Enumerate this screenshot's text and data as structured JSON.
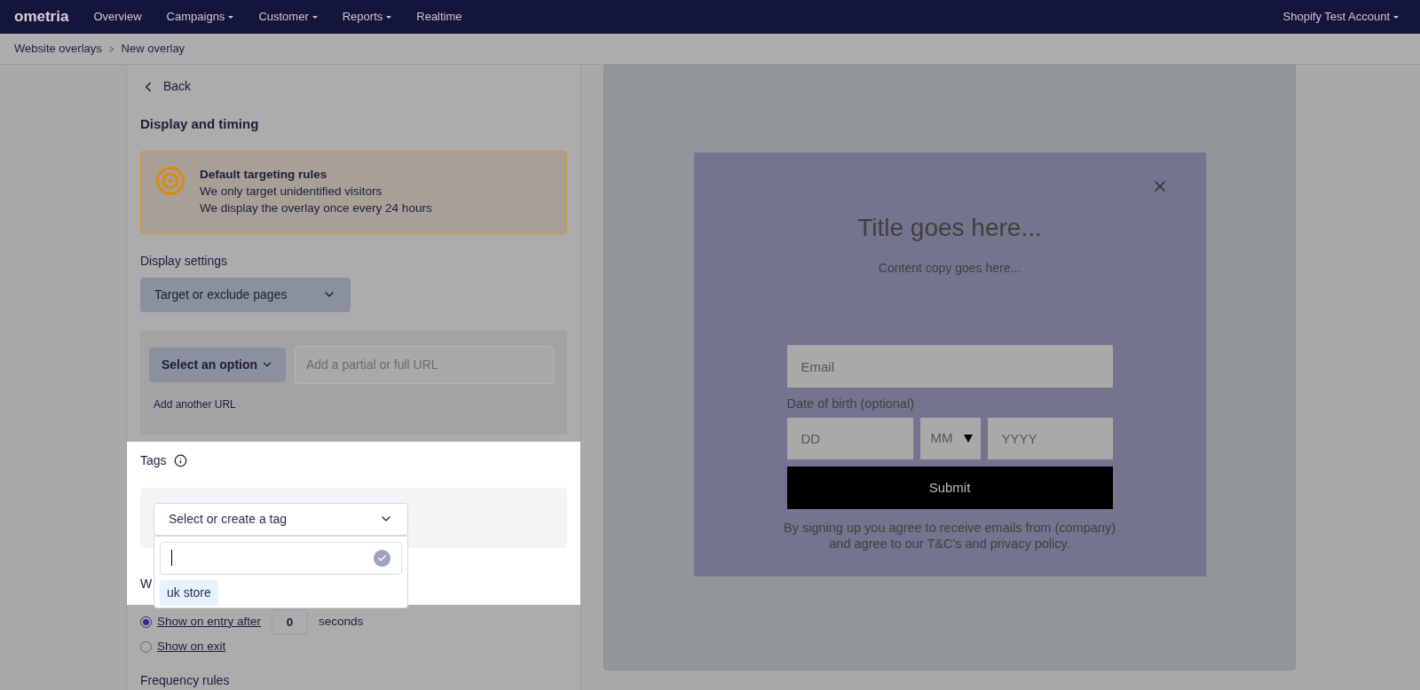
{
  "nav": {
    "logo": "ometria",
    "items": [
      {
        "label": "Overview",
        "dropdown": false
      },
      {
        "label": "Campaigns",
        "dropdown": true
      },
      {
        "label": "Customer",
        "dropdown": true
      },
      {
        "label": "Reports",
        "dropdown": true
      },
      {
        "label": "Realtime",
        "dropdown": false
      }
    ],
    "account": {
      "label": "Shopify Test Account",
      "dropdown": true
    }
  },
  "breadcrumb": {
    "items": [
      "Website overlays",
      "New overlay"
    ],
    "separator": ">"
  },
  "panel": {
    "back": "Back",
    "heading": "Display and timing",
    "alert": {
      "title": "Default targeting rules",
      "lines": [
        "We only target unidentified visitors",
        "We display the overlay once every 24 hours"
      ]
    },
    "display_settings": {
      "label": "Display settings",
      "dropdown": "Target or exclude pages"
    },
    "url_rule": {
      "select": "Select an option",
      "placeholder": "Add a partial or full URL",
      "add_link": "Add another URL"
    },
    "tags": {
      "label": "Tags",
      "select_placeholder": "Select or create a tag",
      "menu": {
        "options": [
          {
            "label": "uk store",
            "highlighted": true
          }
        ]
      }
    },
    "timing": {
      "label": "W",
      "options": [
        {
          "label": "Show on entry after",
          "selected": true,
          "kind": "delay",
          "value": "0",
          "unit": "seconds"
        },
        {
          "label": "Show on exit",
          "selected": false,
          "kind": "plain"
        }
      ]
    },
    "frequency_label": "Frequency rules"
  },
  "preview": {
    "title": "Title goes here...",
    "copy": "Content copy goes here...",
    "email_placeholder": "Email",
    "dob_label": "Date of birth (optional)",
    "day_placeholder": "DD",
    "month_placeholder": "MM",
    "year_placeholder": "YYYY",
    "submit": "Submit",
    "disclaimer": "By signing up you agree to receive emails from (company) and agree to our T&C's and privacy policy."
  }
}
